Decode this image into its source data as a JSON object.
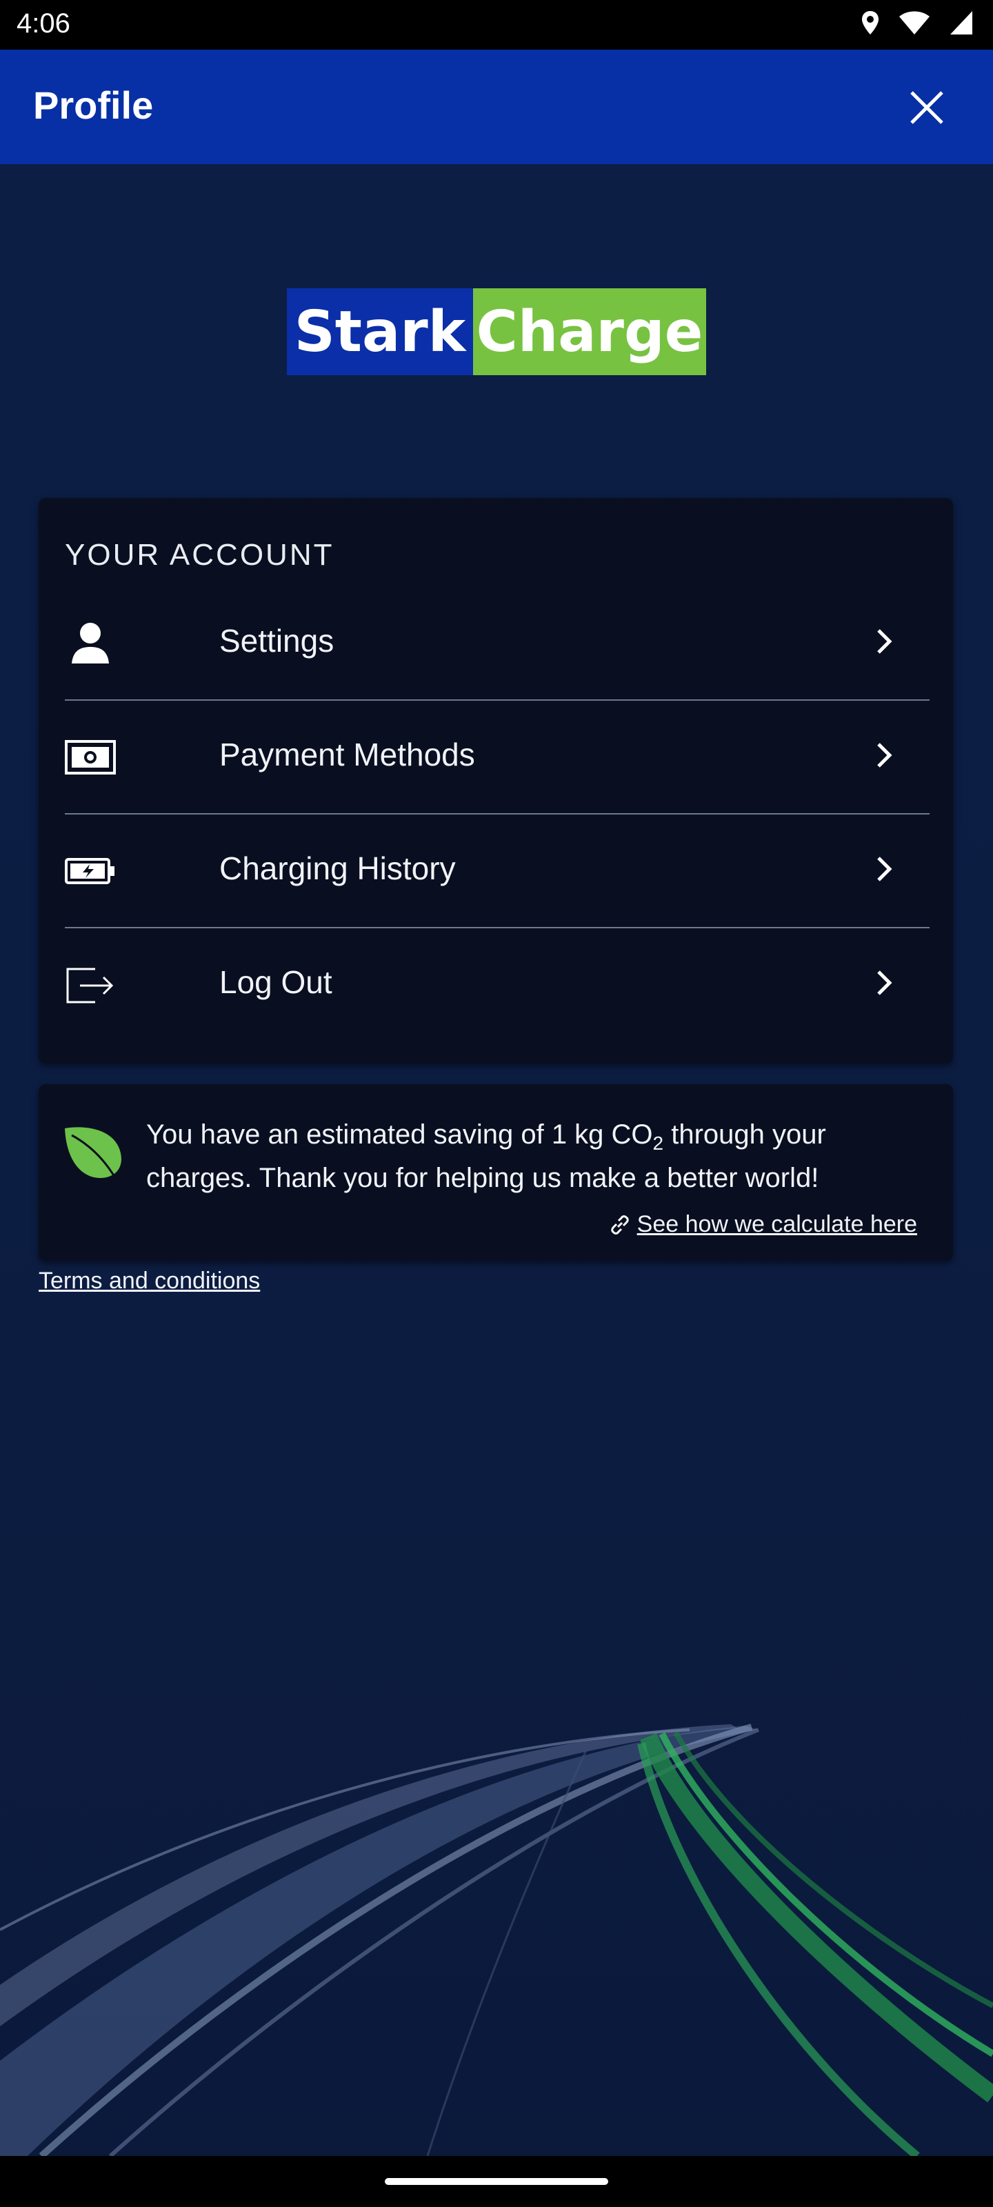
{
  "status_bar": {
    "time": "4:06",
    "icons": [
      "location-icon",
      "wifi-icon",
      "signal-icon"
    ]
  },
  "app_bar": {
    "title": "Profile",
    "close_icon": "close-icon"
  },
  "brand": {
    "part1": "Stark",
    "part2": "Charge",
    "colors": {
      "part1_bg": "#0a2fa8",
      "part2_bg": "#78c242"
    }
  },
  "account": {
    "heading": "YOUR ACCOUNT",
    "items": [
      {
        "label": "Settings",
        "icon": "person-icon"
      },
      {
        "label": "Payment Methods",
        "icon": "cash-icon"
      },
      {
        "label": "Charging History",
        "icon": "battery-charging-icon"
      },
      {
        "label": "Log Out",
        "icon": "logout-icon"
      }
    ]
  },
  "co2": {
    "message_part1": "You have an estimated saving of 1 kg CO",
    "subscript": "2",
    "message_part2": " through your charges. Thank you for helping us make a better world!",
    "link_text": "See how we calculate here",
    "leaf_color": "#6cc24a"
  },
  "footer": {
    "terms": "Terms and conditions"
  },
  "colors": {
    "app_bar": "#0730a6",
    "background": "#0c1d3f",
    "card": "#090f20"
  }
}
